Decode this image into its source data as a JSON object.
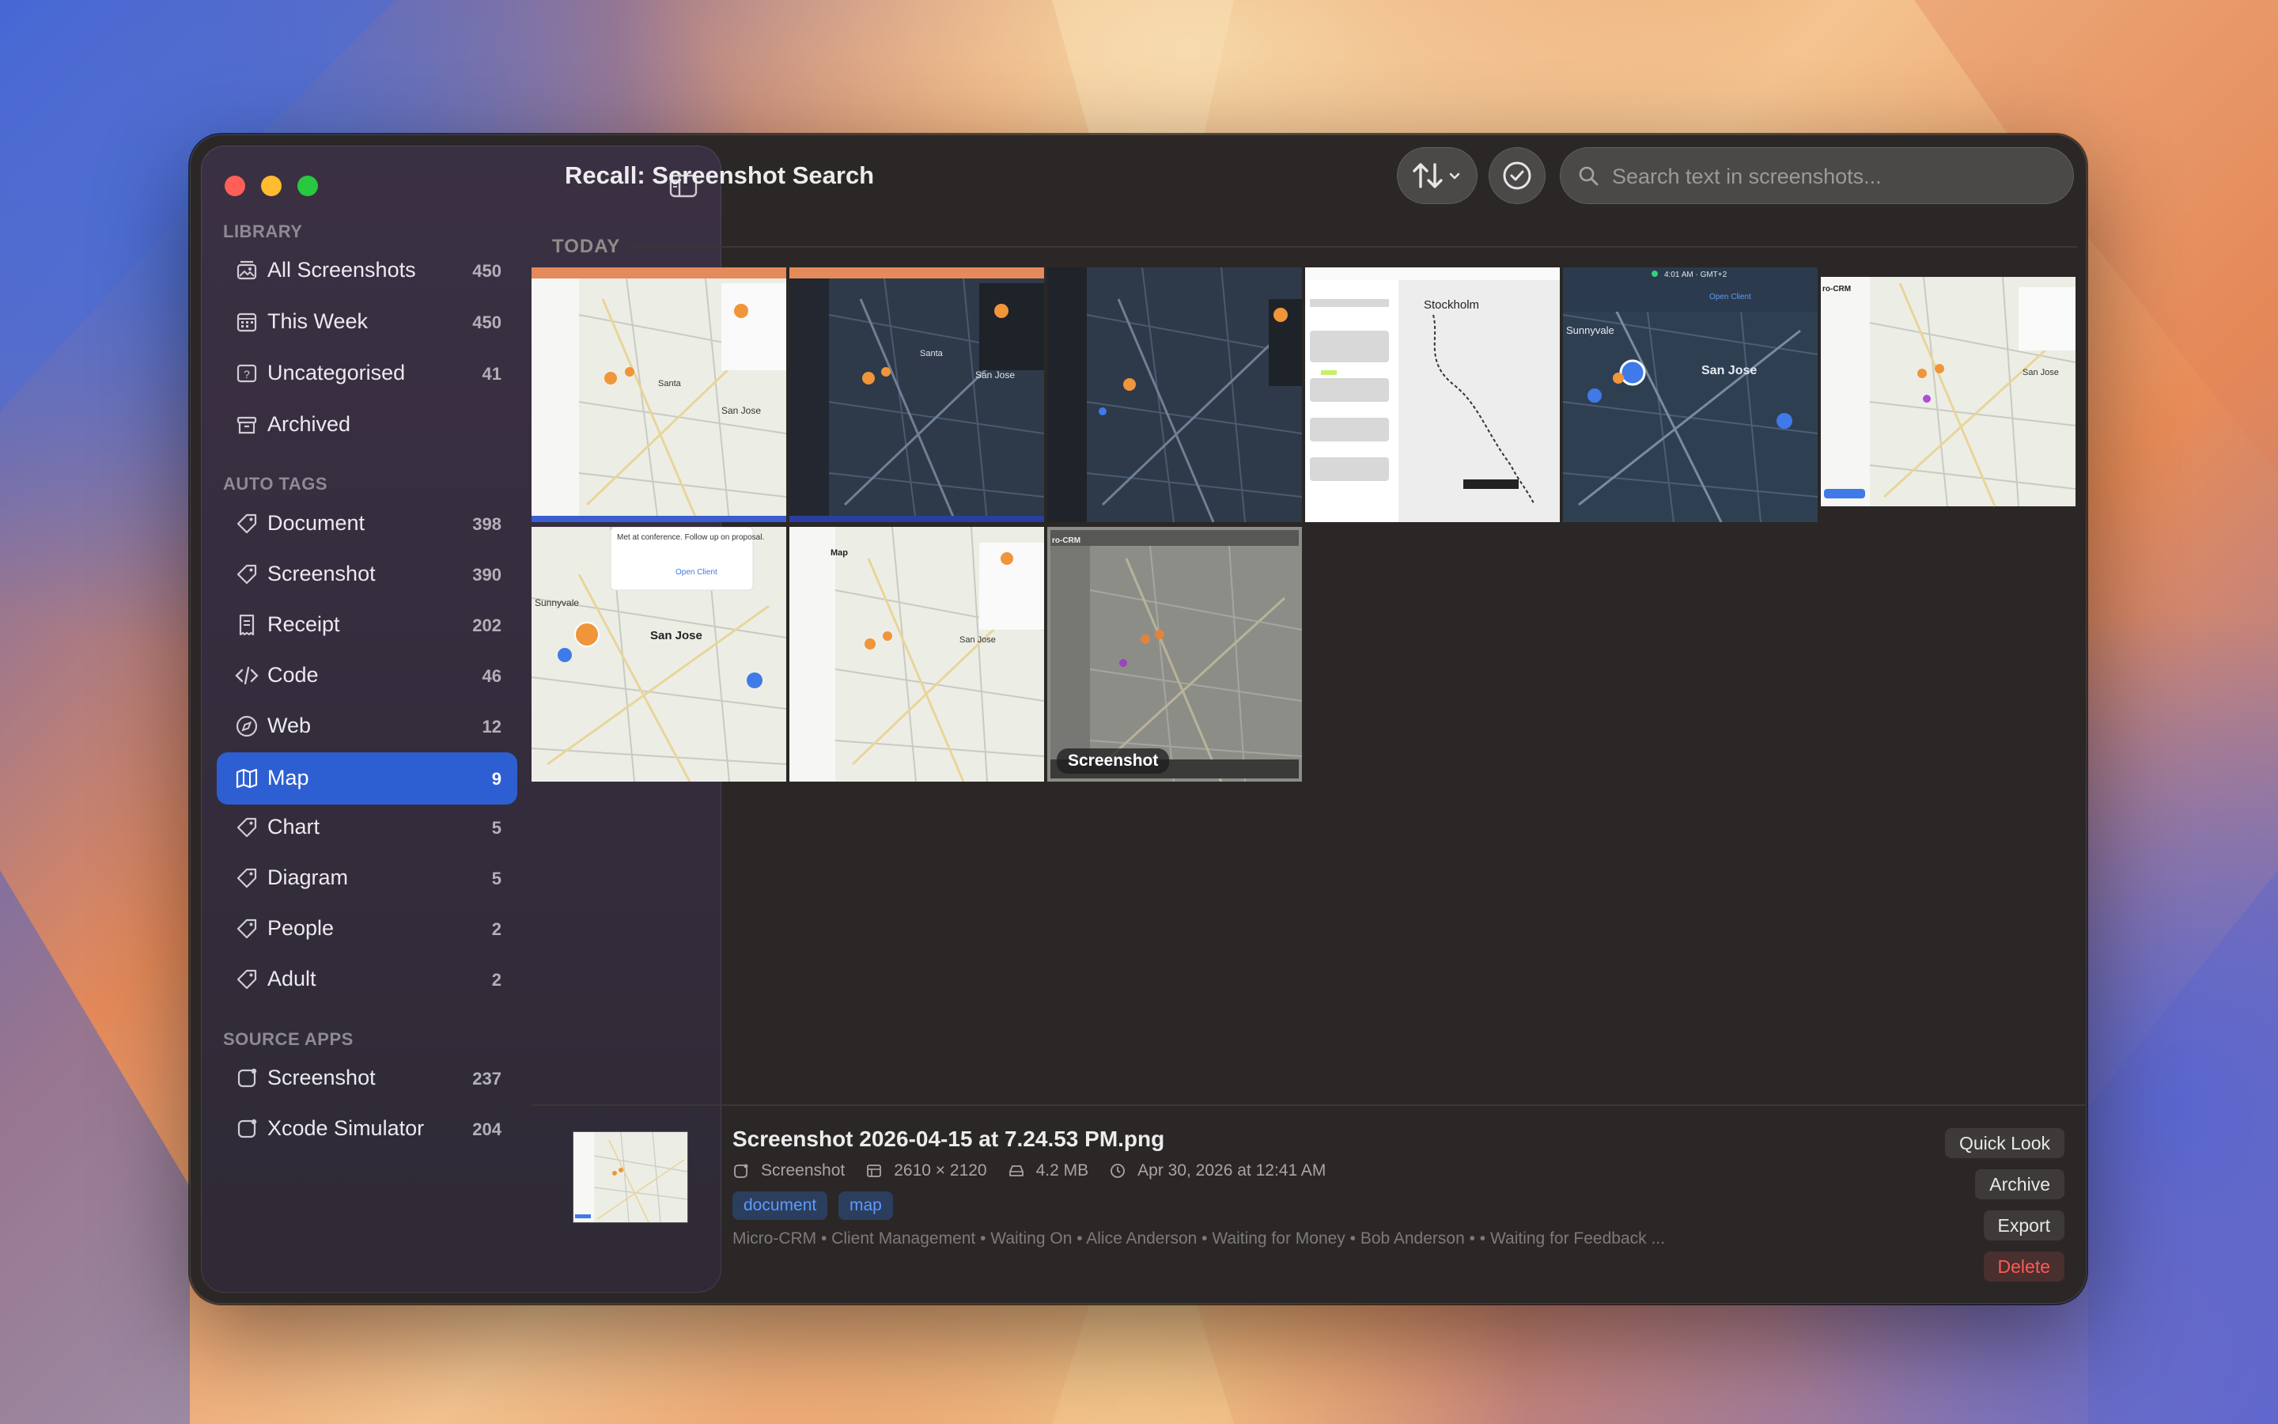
{
  "window": {
    "title": "Recall: Screenshot Search"
  },
  "sidebar": {
    "sections": [
      {
        "label": "LIBRARY",
        "items": [
          {
            "label": "All Screenshots",
            "count": "450",
            "icon": "photo-stack-icon"
          },
          {
            "label": "This Week",
            "count": "450",
            "icon": "calendar-icon"
          },
          {
            "label": "Uncategorised",
            "count": "41",
            "icon": "question-photo-icon"
          },
          {
            "label": "Archived",
            "count": "",
            "icon": "archive-box-icon"
          }
        ]
      },
      {
        "label": "AUTO TAGS",
        "items": [
          {
            "label": "Document",
            "count": "398",
            "icon": "tag-icon"
          },
          {
            "label": "Screenshot",
            "count": "390",
            "icon": "tag-icon"
          },
          {
            "label": "Receipt",
            "count": "202",
            "icon": "receipt-icon"
          },
          {
            "label": "Code",
            "count": "46",
            "icon": "code-icon"
          },
          {
            "label": "Web",
            "count": "12",
            "icon": "compass-icon"
          },
          {
            "label": "Map",
            "count": "9",
            "icon": "map-icon",
            "active": true
          },
          {
            "label": "Chart",
            "count": "5",
            "icon": "tag-icon"
          },
          {
            "label": "Diagram",
            "count": "5",
            "icon": "tag-icon"
          },
          {
            "label": "People",
            "count": "2",
            "icon": "tag-icon"
          },
          {
            "label": "Adult",
            "count": "2",
            "icon": "tag-icon"
          }
        ]
      },
      {
        "label": "SOURCE APPS",
        "items": [
          {
            "label": "Screenshot",
            "count": "237",
            "icon": "app-badge-icon"
          },
          {
            "label": "Xcode Simulator",
            "count": "204",
            "icon": "app-badge-icon"
          }
        ]
      }
    ]
  },
  "toolbar": {
    "search_placeholder": "Search text in screenshots..."
  },
  "gallery": {
    "section_label": "TODAY",
    "thumbnails": [
      {
        "style": "light-map-sidebar",
        "label": ""
      },
      {
        "style": "dark-map",
        "label": ""
      },
      {
        "style": "dark-map",
        "label": ""
      },
      {
        "style": "stockholm-route",
        "label": ""
      },
      {
        "style": "dark-map-pins",
        "label": ""
      },
      {
        "style": "light-map-crm",
        "label": ""
      },
      {
        "style": "light-map-popup",
        "label": ""
      },
      {
        "style": "light-map-sidebar",
        "label": ""
      },
      {
        "style": "gray-map",
        "label": "Screenshot",
        "selected": true
      }
    ],
    "thumb_texts": {
      "popup_note": "Met at conference. Follow up on proposal.",
      "open_client": "Open Client",
      "sunnyvale": "Sunnyvale",
      "santa_clara": "Santa Clara",
      "san_jose": "San Jose",
      "stockholm": "Stockholm",
      "time": "4:01 AM · GMT+2",
      "map_title": "Map",
      "crm": "ro-CRM"
    }
  },
  "detail": {
    "file_name": "Screenshot 2026-04-15 at 7.24.53 PM.png",
    "source": "Screenshot",
    "dimensions": "2610 × 2120",
    "size": "4.2 MB",
    "date": "Apr 30, 2026 at 12:41 AM",
    "tags": [
      "document",
      "map"
    ],
    "snippet": "Micro-CRM • Client Management • Waiting On • Alice Anderson • Waiting for Money • Bob Anderson • • Waiting for Feedback ...",
    "actions": {
      "quick_look": "Quick Look",
      "archive": "Archive",
      "export": "Export",
      "delete": "Delete"
    }
  }
}
